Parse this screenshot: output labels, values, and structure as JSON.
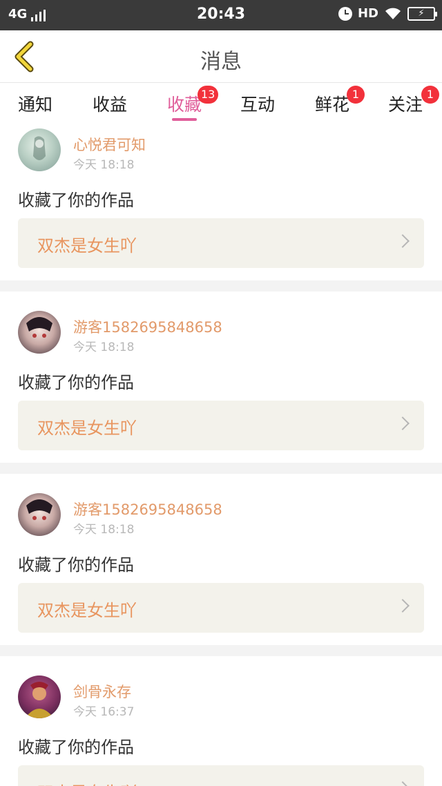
{
  "status_bar": {
    "network": "4G",
    "time": "20:43",
    "hd": "HD",
    "icons": [
      "signal-icon",
      "alarm-icon",
      "wifi-icon",
      "battery-charging-icon"
    ]
  },
  "nav": {
    "title": "消息",
    "back_icon": "chevron-left-icon",
    "back_color": "#f2d63a"
  },
  "tabs": [
    {
      "label": "通知",
      "badge": ""
    },
    {
      "label": "收益",
      "badge": ""
    },
    {
      "label": "收藏",
      "badge": "13",
      "active": true
    },
    {
      "label": "互动",
      "badge": ""
    },
    {
      "label": "鲜花",
      "badge": "1"
    },
    {
      "label": "关注",
      "badge": "1"
    }
  ],
  "colors": {
    "accent": "#e05e9a",
    "badge": "#f2313b",
    "username": "#e29a6a",
    "work_title": "#e8955f"
  },
  "messages": [
    {
      "user": "心悦君可知",
      "time": "今天 18:18",
      "text": "收藏了你的作品",
      "work": "双杰是女生吖"
    },
    {
      "user": "游客1582695848658",
      "time": "今天 18:18",
      "text": "收藏了你的作品",
      "work": "双杰是女生吖"
    },
    {
      "user": "游客1582695848658",
      "time": "今天 18:18",
      "text": "收藏了你的作品",
      "work": "双杰是女生吖"
    },
    {
      "user": "剑骨永存",
      "time": "今天 16:37",
      "text": "收藏了你的作品",
      "work": "双杰是女生吖"
    }
  ]
}
